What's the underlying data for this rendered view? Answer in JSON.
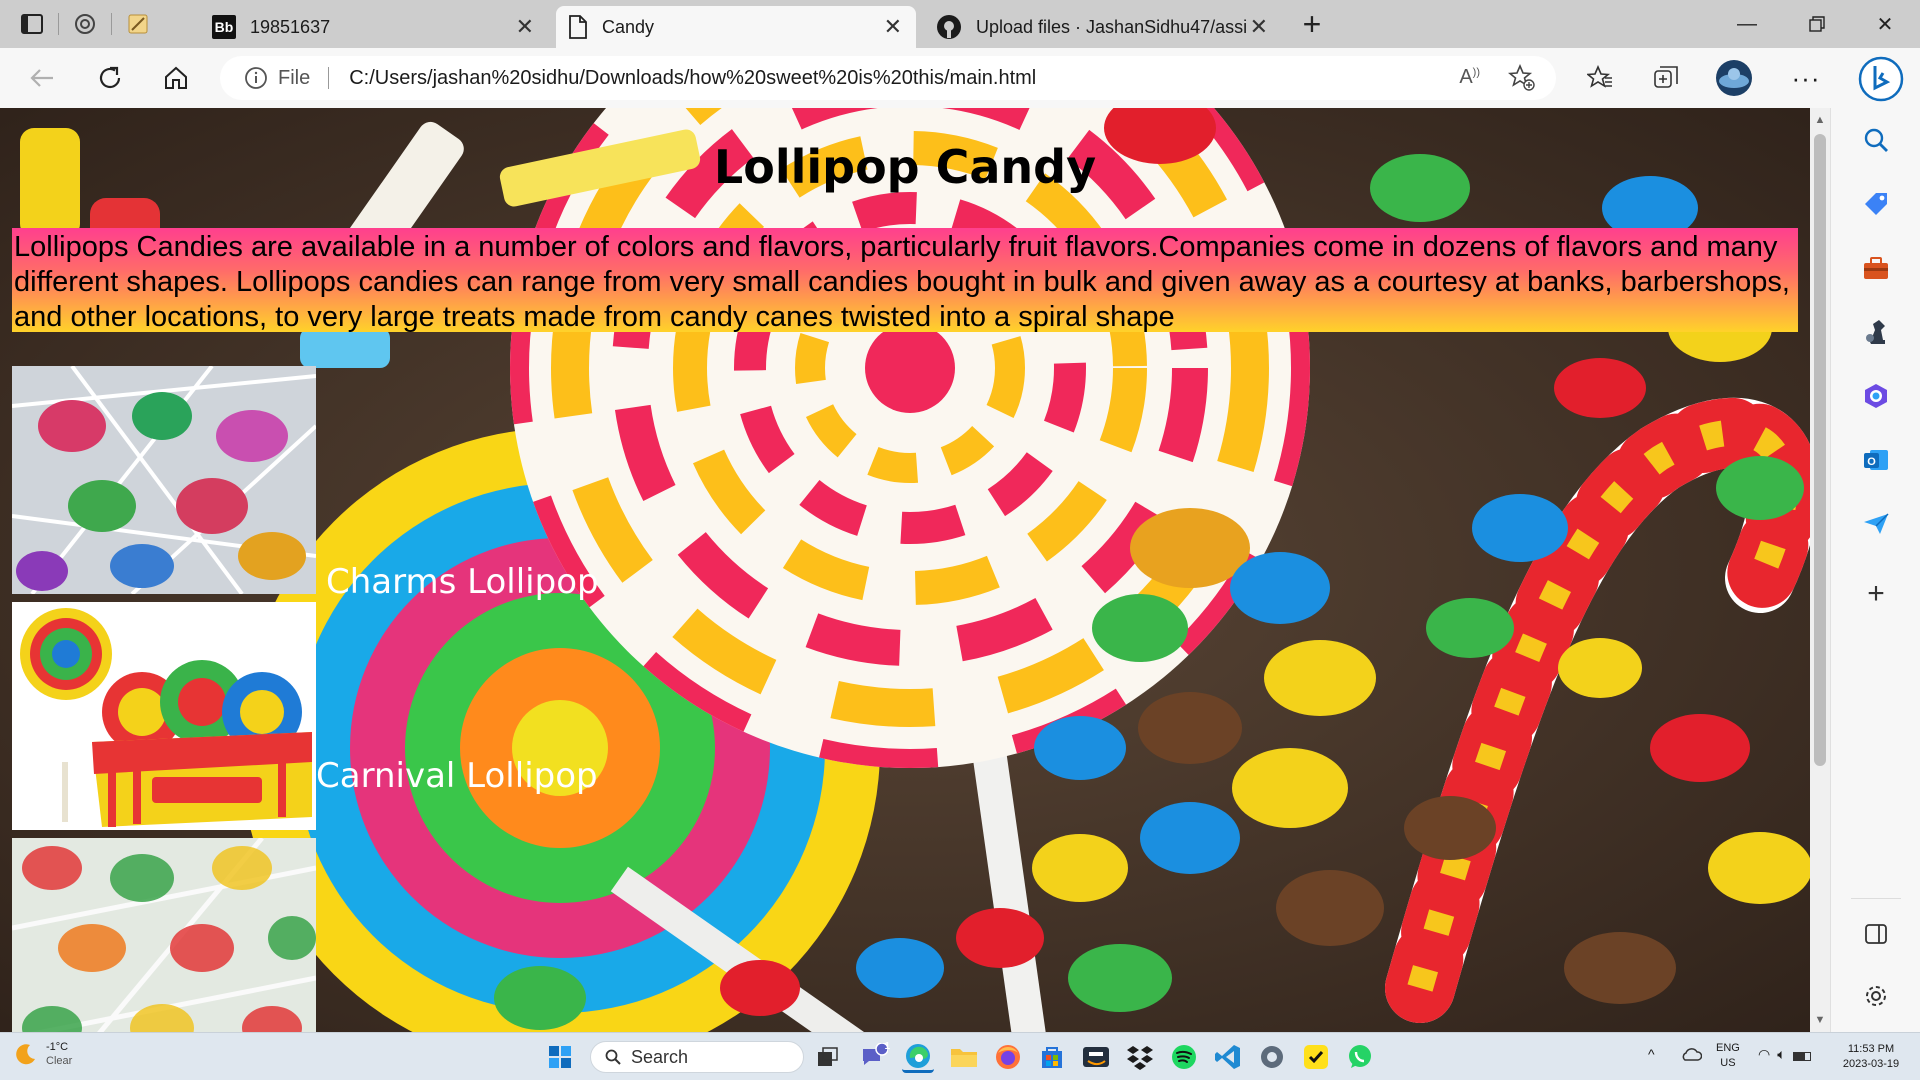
{
  "browser": {
    "tabs": [
      {
        "title": "19851637",
        "icon": "blackboard-icon"
      },
      {
        "title": "Candy",
        "icon": "page-icon",
        "active": true
      },
      {
        "title": "Upload files · JashanSidhu47/assi",
        "icon": "github-icon"
      }
    ],
    "address": {
      "scheme_label": "File",
      "url": "C:/Users/jashan%20sidhu/Downloads/how%20sweet%20is%20this/main.html"
    }
  },
  "page": {
    "title": "Lollipop Candy",
    "description": "Lollipops Candies are available in a number of colors and flavors, particularly fruit flavors.Companies come in dozens of flavors and many different shapes. Lollipops candies can range from very small candies bought in bulk and given away as a courtesy at banks, barbershops, and other locations, to very large treats made from candy canes twisted into a spiral shape",
    "products": [
      {
        "label": "Charms Lollipop"
      },
      {
        "label": "Carnival Lollipop"
      },
      {
        "label": ""
      }
    ]
  },
  "taskbar": {
    "weather_temp": "-1°C",
    "weather_desc": "Clear",
    "search_label": "Search",
    "language_line1": "ENG",
    "language_line2": "US",
    "time": "11:53 PM",
    "date": "2023-03-19",
    "chat_badge": "1"
  },
  "colors": {
    "gradient_top": "#ff3f8e",
    "gradient_bottom": "#ffd22a",
    "edge_accent": "#0f6cbd"
  }
}
